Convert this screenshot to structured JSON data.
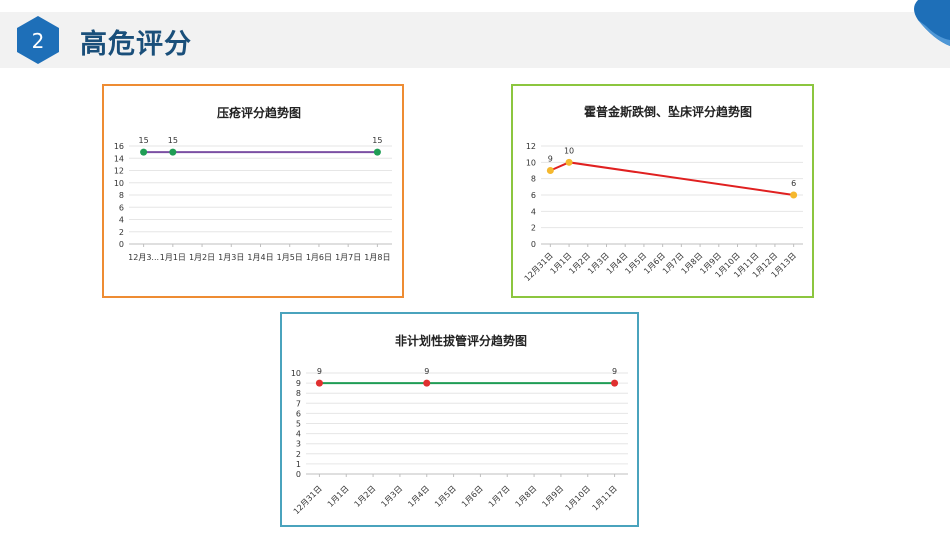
{
  "header": {
    "section_number": "2",
    "title": "高危评分",
    "accent_color": "#1e6fb8"
  },
  "chart_data": [
    {
      "type": "line",
      "title": "压疮评分趋势图",
      "categories": [
        "12月3...",
        "1月1日",
        "1月2日",
        "1月3日",
        "1月4日",
        "1月5日",
        "1月6日",
        "1月7日",
        "1月8日"
      ],
      "series": [
        {
          "values": [
            15,
            15,
            null,
            null,
            null,
            null,
            null,
            null,
            15
          ],
          "line_color": "#7b4fa3",
          "marker_color": "#1f9d55"
        }
      ],
      "y_ticks": [
        0,
        2,
        4,
        6,
        8,
        10,
        12,
        14,
        16
      ],
      "ylim": [
        0,
        16
      ],
      "grid": true,
      "rotated_x_labels": false,
      "frame_color": "#ee8c33"
    },
    {
      "type": "line",
      "title": "霍普金斯跌倒、坠床评分趋势图",
      "categories": [
        "12月31日",
        "1月1日",
        "1月2日",
        "1月3日",
        "1月4日",
        "1月5日",
        "1月6日",
        "1月7日",
        "1月8日",
        "1月9日",
        "1月10日",
        "1月11日",
        "1月12日",
        "1月13日"
      ],
      "series": [
        {
          "values": [
            9,
            10,
            null,
            null,
            null,
            null,
            null,
            null,
            null,
            null,
            null,
            null,
            null,
            6
          ],
          "line_color": "#e02020",
          "marker_color": "#f5b82e"
        }
      ],
      "y_ticks": [
        0,
        2,
        4,
        6,
        8,
        10,
        12
      ],
      "ylim": [
        0,
        12
      ],
      "grid": true,
      "rotated_x_labels": true,
      "frame_color": "#8cc63f"
    },
    {
      "type": "line",
      "title": "非计划性拔管评分趋势图",
      "categories": [
        "12月31日",
        "1月1日",
        "1月2日",
        "1月3日",
        "1月4日",
        "1月5日",
        "1月6日",
        "1月7日",
        "1月8日",
        "1月9日",
        "1月10日",
        "1月11日"
      ],
      "series": [
        {
          "values": [
            9,
            null,
            null,
            null,
            9,
            null,
            null,
            null,
            null,
            null,
            null,
            9
          ],
          "line_color": "#1f9d55",
          "marker_color": "#e03030"
        }
      ],
      "y_ticks": [
        0,
        1,
        2,
        3,
        4,
        5,
        6,
        7,
        8,
        9,
        10
      ],
      "ylim": [
        0,
        10
      ],
      "grid": true,
      "rotated_x_labels": true,
      "frame_color": "#4aa3bd"
    }
  ]
}
